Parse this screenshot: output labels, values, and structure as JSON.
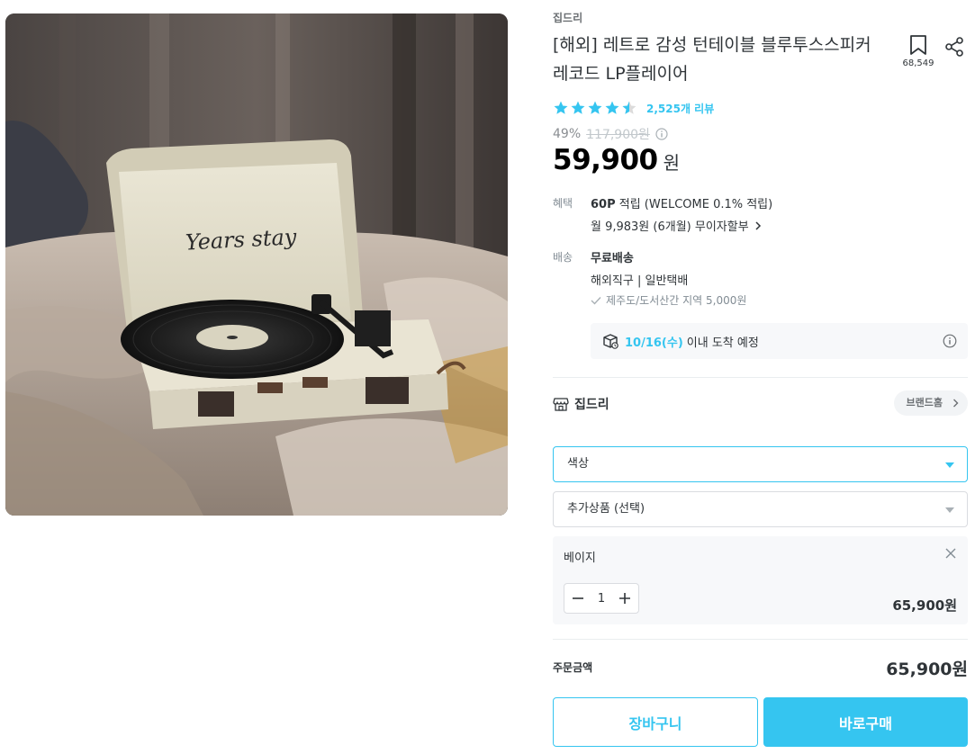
{
  "product": {
    "brand": "집드리",
    "title": "[해외] 레트로 감성 턴테이블 블루투스스피커 레코드 LP플레이어",
    "bookmark_count": "68,549",
    "rating": 4.5,
    "review_count": "2,525개 리뷰",
    "discount": "49%",
    "original_price": "117,900원",
    "price": "59,900",
    "currency": "원",
    "image_lid_text": "Years stay"
  },
  "benefit": {
    "label": "혜택",
    "points": "60P",
    "points_suffix": " 적립 (WELCOME 0.1% 적립)",
    "installment": "월 9,983원 (6개월) 무이자할부"
  },
  "shipping": {
    "label": "배송",
    "type": "무료배송",
    "method": "해외직구 | 일반택배",
    "extra": "제주도/도서산간 지역 5,000원",
    "arrival_date": "10/16(수)",
    "arrival_suffix": "이내 도착 예정"
  },
  "store": {
    "name": "집드리",
    "brand_home": "브랜드홈"
  },
  "options": {
    "color_select": "색상",
    "addon_select": "추가상품 (선택)"
  },
  "selected_item": {
    "name": "베이지",
    "quantity": "1",
    "price": "65,900원"
  },
  "order": {
    "total_label": "주문금액",
    "total_price": "65,900원",
    "cart_button": "장바구니",
    "buy_button": "바로구매"
  },
  "colors": {
    "accent": "#35c5f0",
    "text": "#2f3438",
    "muted": "#828c94"
  }
}
